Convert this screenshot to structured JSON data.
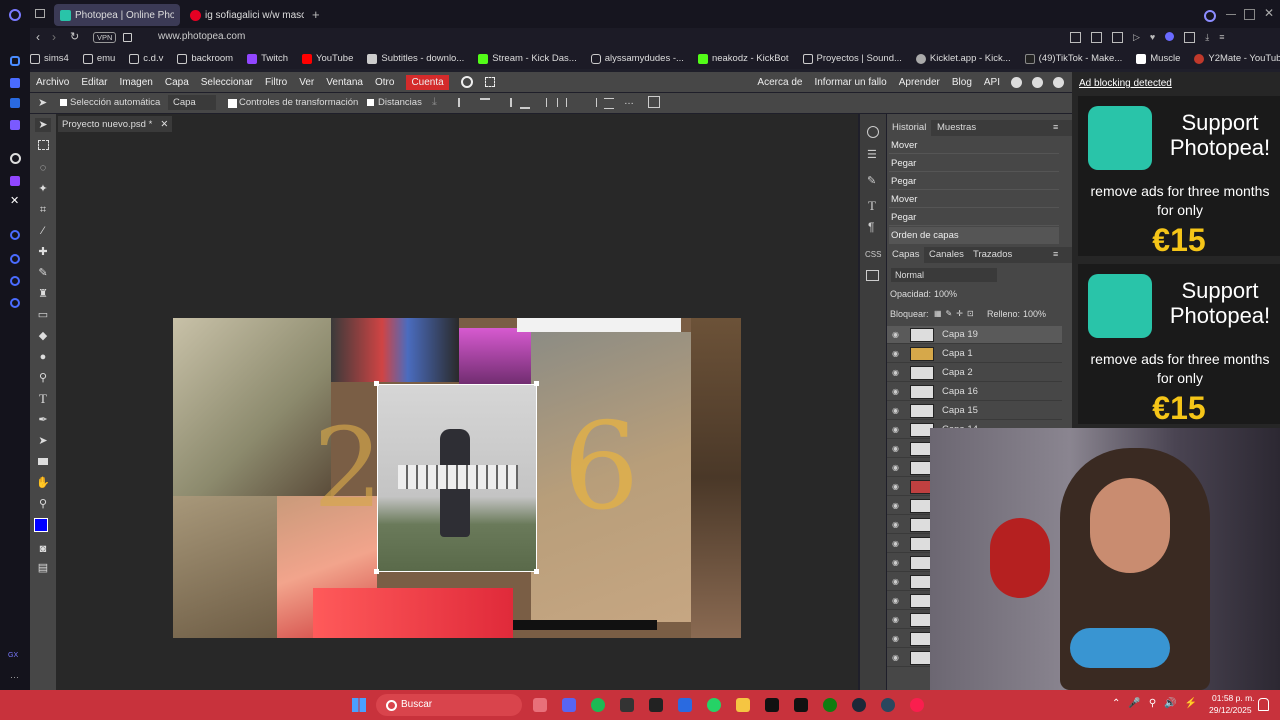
{
  "browser": {
    "tabs": [
      {
        "label": "Photopea | Online Photo E",
        "active": true
      },
      {
        "label": "ig sofiagalici w/w masc",
        "active": false
      }
    ],
    "new_tab": "+",
    "vpn": "VPN",
    "url": "www.photopea.com",
    "bookmarks": [
      "sims4",
      "emu",
      "c.d.v",
      "backroom",
      "Twitch",
      "YouTube",
      "Subtitles - downlo...",
      "Stream - Kick Das...",
      "alyssamydudes -...",
      "neakodz - KickBot",
      "Proyectos | Sound...",
      "Kicklet.app - Kick...",
      "(49)TikTok - Make...",
      "Muscle",
      "Y2Mate - YouTube..."
    ]
  },
  "photopea": {
    "menu": [
      "Archivo",
      "Editar",
      "Imagen",
      "Capa",
      "Seleccionar",
      "Filtro",
      "Ver",
      "Ventana",
      "Otro",
      "Cuenta"
    ],
    "menu_right": [
      "Acerca de",
      "Informar un fallo",
      "Aprender",
      "Blog",
      "API"
    ],
    "options": {
      "auto_select": "Selección automática",
      "layer_select": "Capa",
      "transform": "Controles de transformación",
      "distances": "Distancias"
    },
    "doc_tab": "Proyecto nuevo.psd *",
    "history": {
      "tabs": [
        "Historial",
        "Muestras"
      ],
      "rows": [
        "Mover",
        "Pegar",
        "Pegar",
        "Mover",
        "Pegar",
        "Orden de capas"
      ]
    },
    "layers": {
      "tabs": [
        "Capas",
        "Canales",
        "Trazados"
      ],
      "blend": "Normal",
      "opacity_label": "Opacidad:",
      "opacity": "100%",
      "lock_label": "Bloquear:",
      "fill_label": "Relleno:",
      "fill": "100%",
      "rows": [
        "Capa 19",
        "Capa 1",
        "Capa 2",
        "Capa 16",
        "Capa 15",
        "Capa 14"
      ]
    }
  },
  "ads": {
    "header": "Ad blocking detected",
    "title": "Support Photopea!",
    "text": "remove ads for three months for only",
    "price": "€15"
  },
  "taskbar": {
    "search": "Buscar",
    "time": "01:58 p. m.",
    "date": "29/12/2025"
  },
  "colors": {
    "accent_red": "#d42b2b",
    "photopea_teal": "#29c4a9",
    "taskbar": "#c8323c"
  }
}
